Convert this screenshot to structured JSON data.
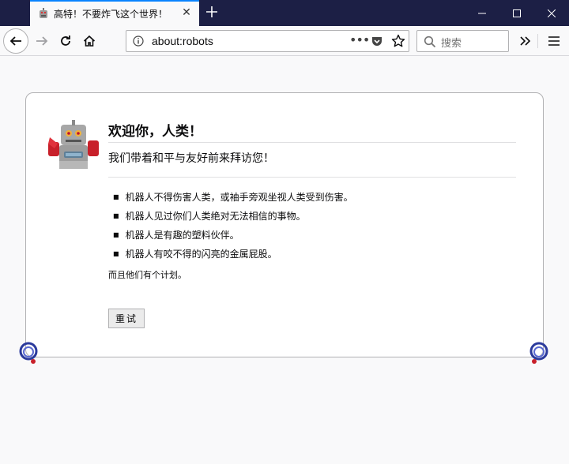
{
  "tab": {
    "title": "高特！不要炸飞这个世界！"
  },
  "urlbar": {
    "value": "about:robots"
  },
  "searchbar": {
    "placeholder": "搜索"
  },
  "page": {
    "heading": "欢迎你，人类！",
    "subheading": "我们带着和平与友好前来拜访您！",
    "laws": [
      "机器人不得伤害人类，或袖手旁观坐视人类受到伤害。",
      "机器人见过你们人类绝对无法相信的事物。",
      "机器人是有趣的塑料伙伴。",
      "机器人有咬不得的闪亮的金属屁股。"
    ],
    "plan": "而且他们有个计划。",
    "retry_label": "重试"
  },
  "icons": {
    "favicon": "robot-favicon-icon",
    "close": "close-icon",
    "new_tab": "plus-icon",
    "back": "back-arrow-icon",
    "forward": "forward-arrow-icon",
    "reload": "reload-icon",
    "home": "home-icon",
    "info": "info-icon",
    "page_actions": "more-dots-icon",
    "pocket": "pocket-icon",
    "bookmark": "star-icon",
    "search": "search-icon",
    "overflow": "chevron-double-right-icon",
    "menu": "hamburger-menu-icon"
  },
  "colors": {
    "titlebar": "#1c1f45",
    "tab_accent": "#0a84ff",
    "page_bg": "#f9f9fa"
  }
}
